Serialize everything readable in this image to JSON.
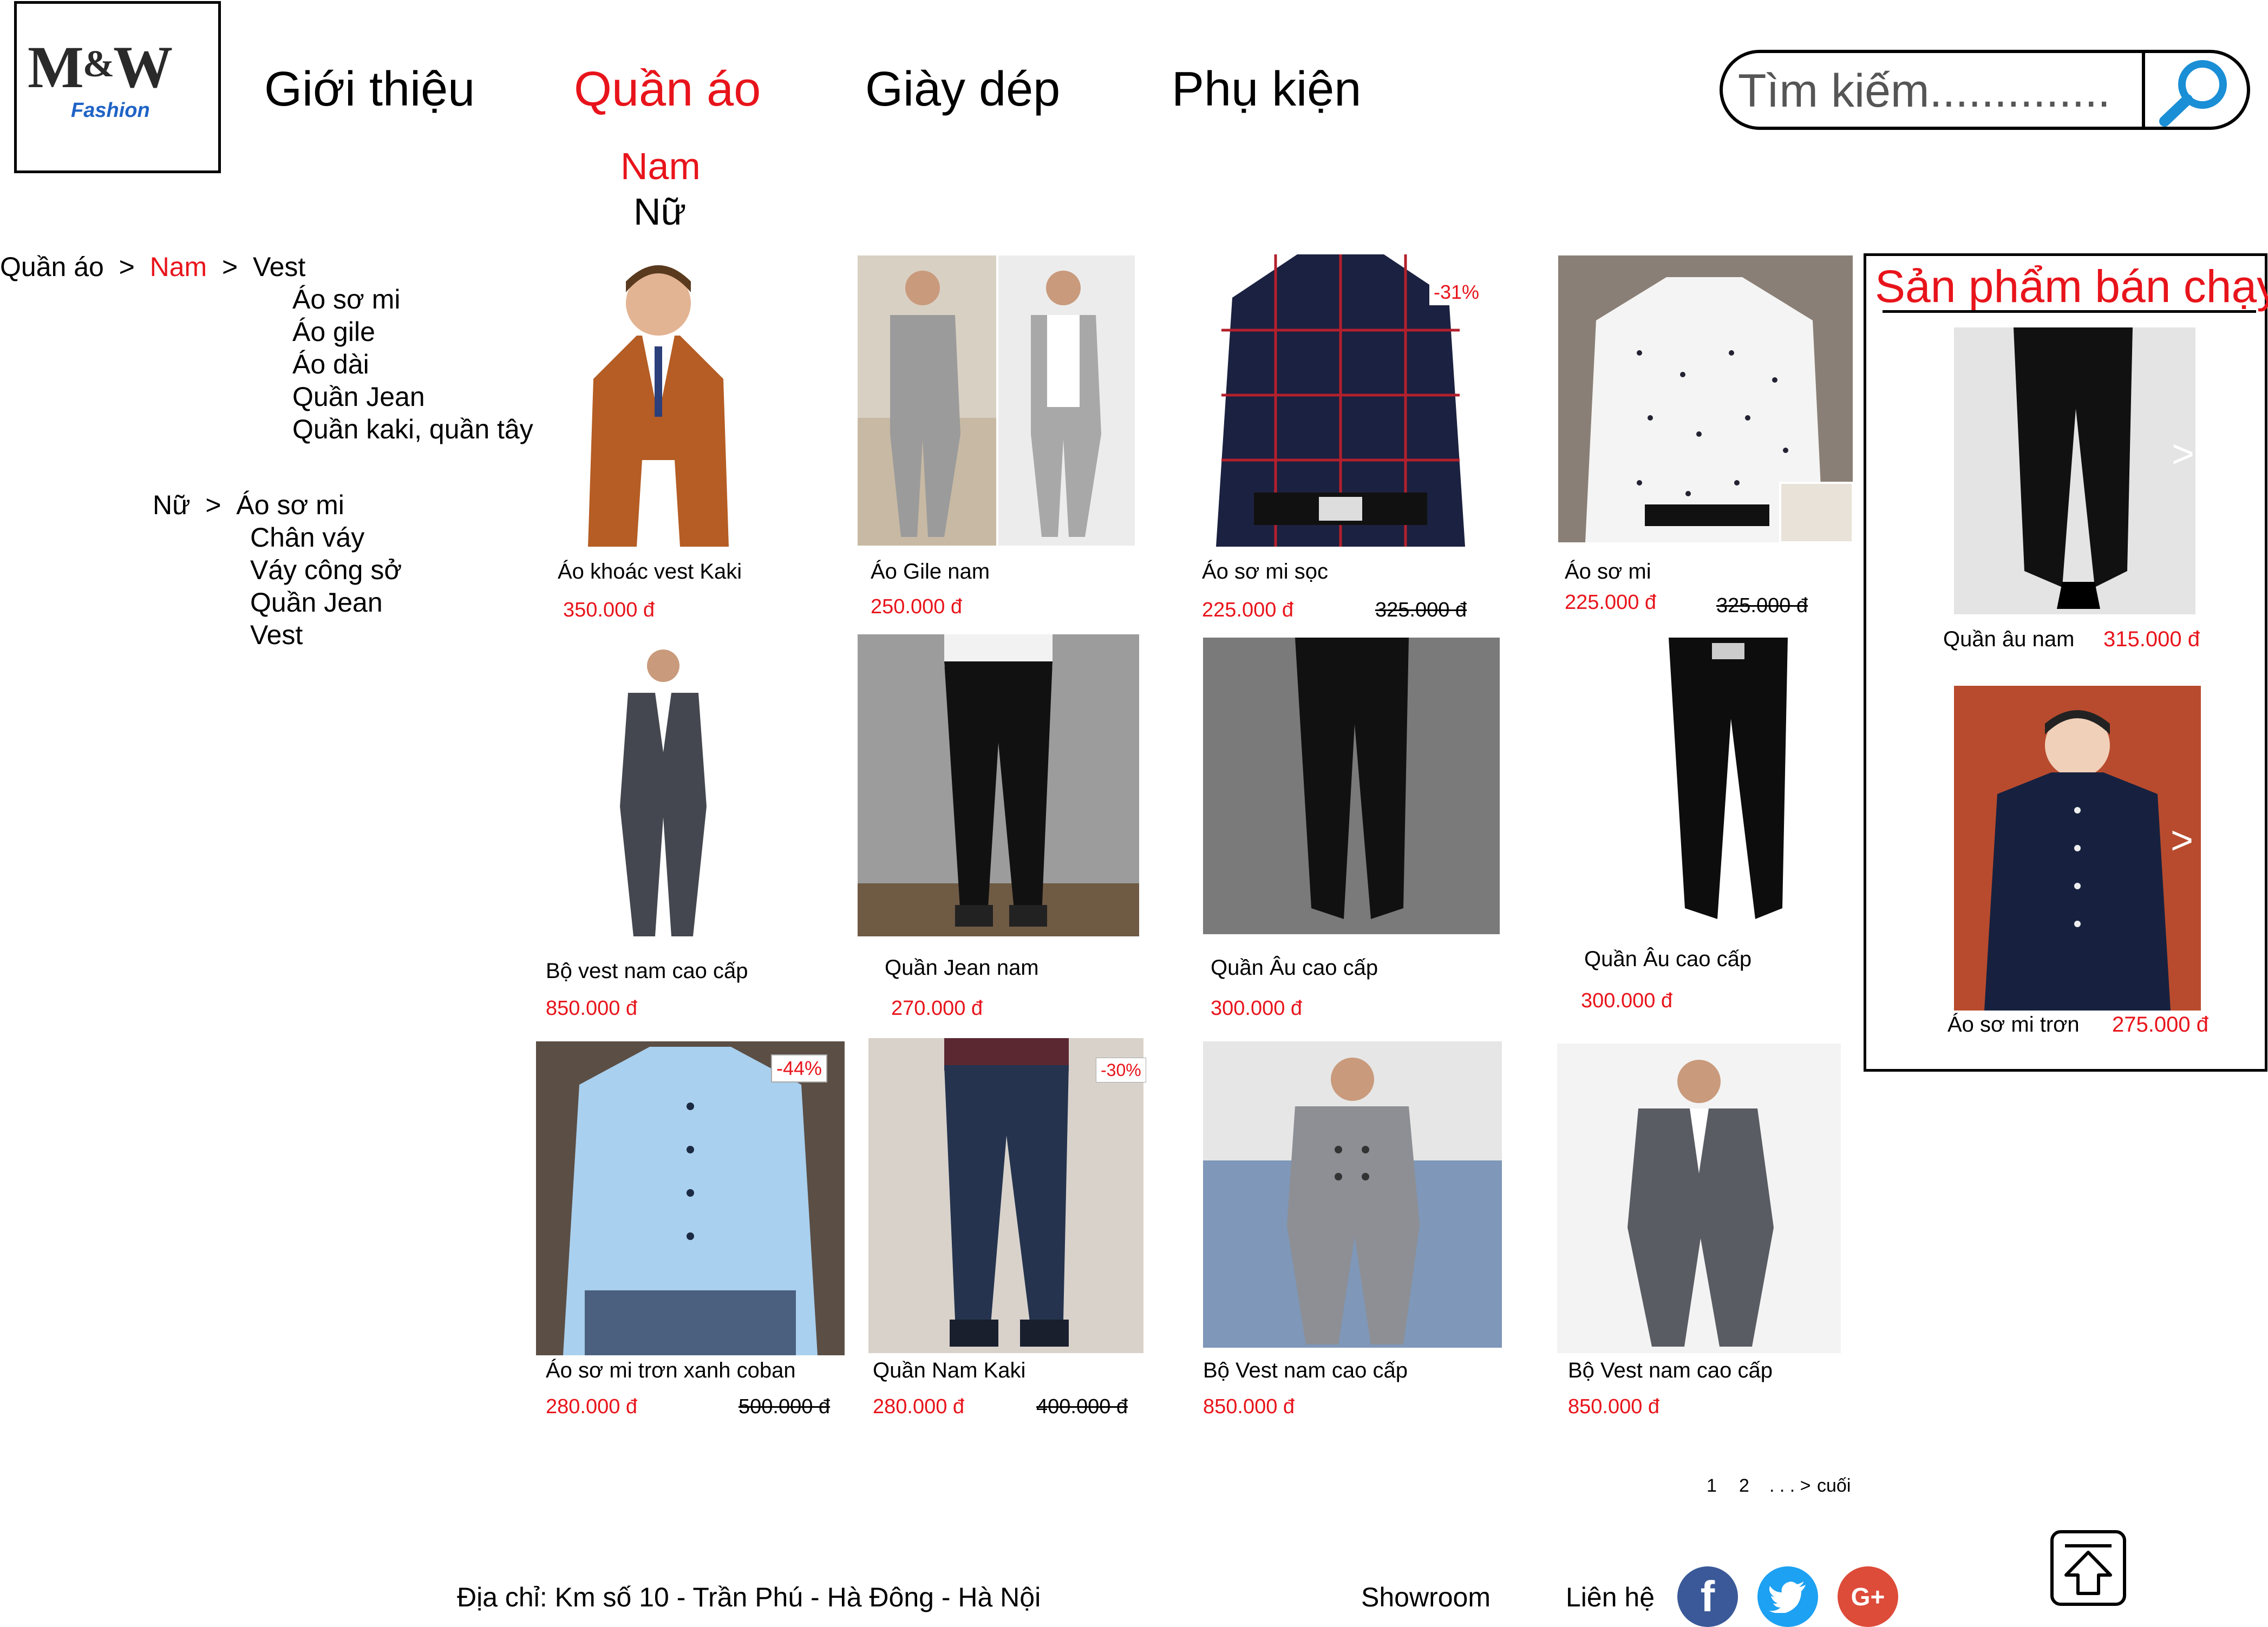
{
  "logo": {
    "main": "M",
    "amp": "&",
    "main2": "W",
    "sub": "Fashion"
  },
  "nav": {
    "items": [
      "Giới thiệu",
      "Quần áo",
      "Giày dép",
      "Phụ kiện"
    ],
    "active_index": 1,
    "submenu": [
      "Nam",
      "Nữ"
    ]
  },
  "search": {
    "placeholder": "Tìm kiếm.............."
  },
  "sidebar": {
    "breadcrumb": {
      "root": "Quần áo",
      "sep": ">",
      "current": "Nam",
      "leaf": "Vest"
    },
    "nam_items": [
      "Áo sơ mi",
      "Áo gile",
      "Áo dài",
      "Quần Jean",
      "Quần kaki, quần tây"
    ],
    "nu_label": "Nữ",
    "nu_sep": ">",
    "nu_items": [
      "Áo sơ mi",
      "Chân váy",
      "Váy công sở",
      "Quần Jean",
      "Vest"
    ]
  },
  "products": [
    {
      "name": "Áo khoác vest Kaki",
      "price": "350.000 đ",
      "old_price": "",
      "badge": ""
    },
    {
      "name": "Áo Gile nam",
      "price": "250.000 đ",
      "old_price": "",
      "badge": ""
    },
    {
      "name": "Áo sơ mi sọc",
      "price": "225.000 đ",
      "old_price": "325.000 đ",
      "badge": "-31%"
    },
    {
      "name": "Áo sơ mi",
      "price": "225.000 đ",
      "old_price": "325.000 đ",
      "badge": ""
    },
    {
      "name": "Bộ vest nam cao cấp",
      "price": "850.000 đ",
      "old_price": "",
      "badge": ""
    },
    {
      "name": "Quần Jean nam",
      "price": "270.000 đ",
      "old_price": "",
      "badge": ""
    },
    {
      "name": "Quần Âu cao cấp",
      "price": "300.000 đ",
      "old_price": "",
      "badge": ""
    },
    {
      "name": "Quần Âu cao cấp",
      "price": "300.000 đ",
      "old_price": "",
      "badge": ""
    },
    {
      "name": "Áo sơ mi trơn xanh coban",
      "price": "280.000 đ",
      "old_price": "500.000 đ",
      "badge": "-44%"
    },
    {
      "name": "Quần Nam Kaki",
      "price": "280.000 đ",
      "old_price": "400.000 đ",
      "badge": "-30%"
    },
    {
      "name": "Bộ Vest nam cao cấp",
      "price": "850.000 đ",
      "old_price": "",
      "badge": ""
    },
    {
      "name": "Bộ Vest nam cao cấp",
      "price": "850.000 đ",
      "old_price": "",
      "badge": ""
    }
  ],
  "bestseller": {
    "title": "Sản phẩm bán chạy",
    "arrow": ">",
    "items": [
      {
        "name": "Quần âu nam",
        "price": "315.000 đ"
      },
      {
        "name": "Áo sơ mi trơn",
        "price": "275.000 đ"
      }
    ]
  },
  "pagination": {
    "pages": [
      "1",
      "2"
    ],
    "ellipsis": ". . . >",
    "last": "cuối"
  },
  "footer": {
    "address": "Địa chỉ: Km số 10 - Trần Phú - Hà Đông - Hà Nội",
    "showroom": "Showroom",
    "contact": "Liên hệ",
    "social": {
      "facebook": "f",
      "twitter": "t",
      "google": "G+"
    }
  },
  "colors": {
    "accent_red": "#e8141b",
    "logo_blue": "#1f63c6",
    "search_icon": "#1a8fd6",
    "facebook": "#3b5998",
    "twitter": "#1da1f2",
    "google": "#dd4b39"
  },
  "icons": [
    "search-icon",
    "facebook-icon",
    "twitter-icon",
    "google-plus-icon",
    "back-to-top-icon"
  ]
}
